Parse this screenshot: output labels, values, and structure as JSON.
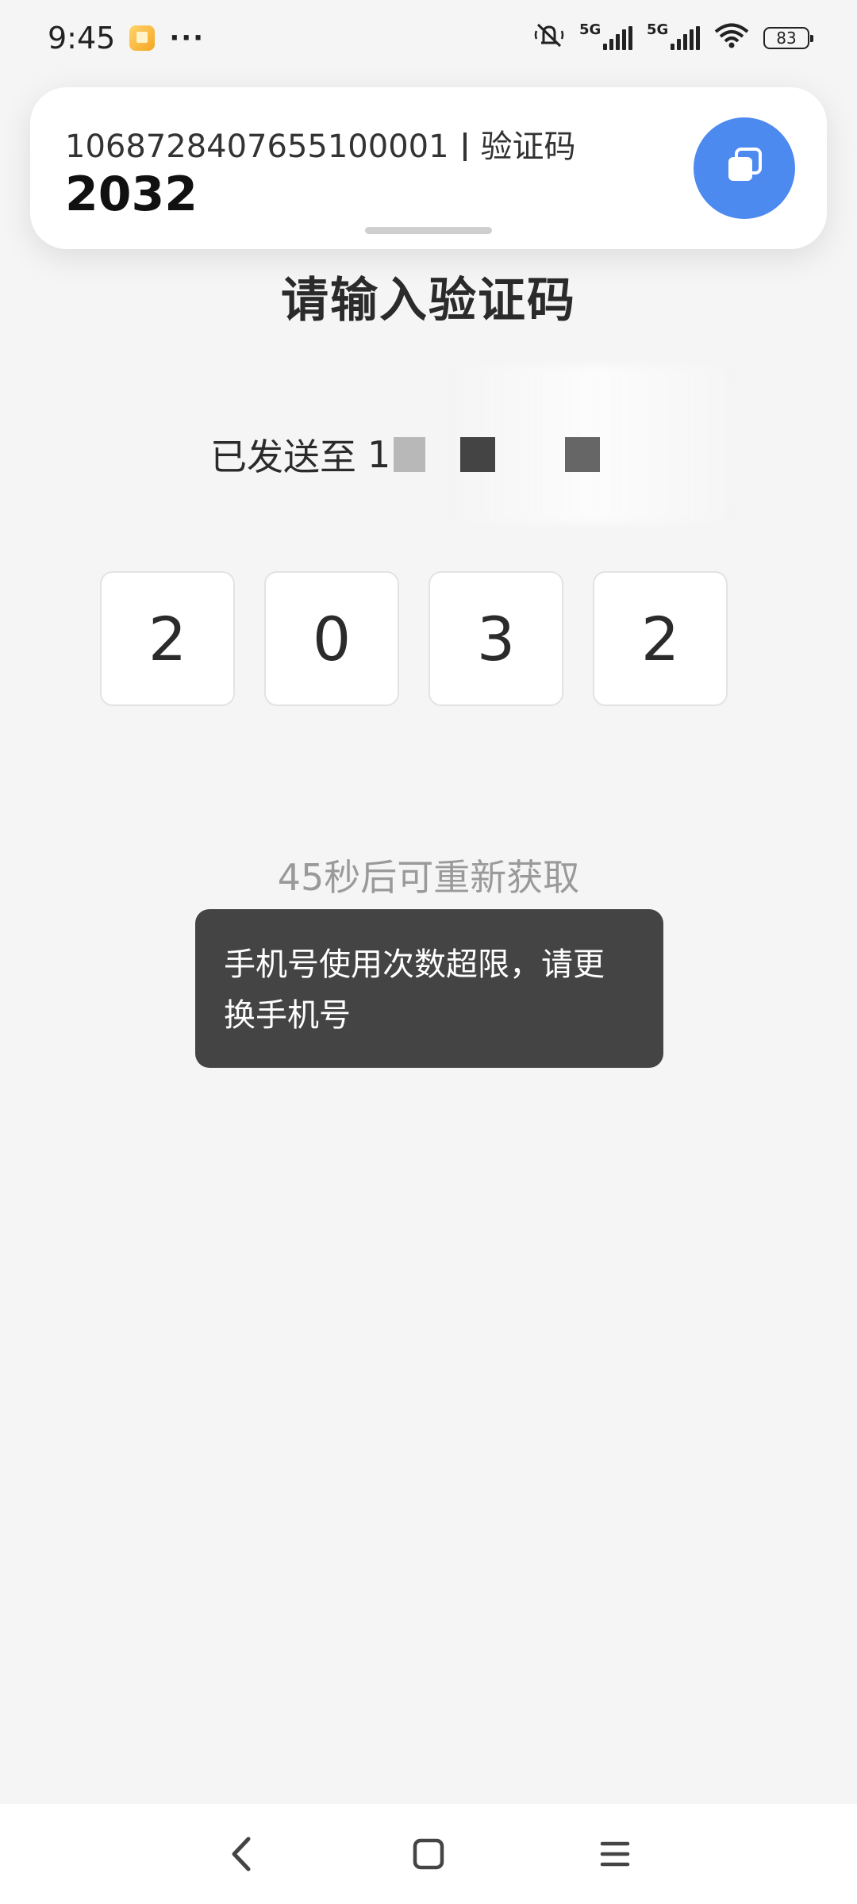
{
  "status_bar": {
    "time": "9:45",
    "more": "···",
    "network_1": "5G",
    "network_2": "5G",
    "battery": "83"
  },
  "notification": {
    "sender": "1068728407655100001",
    "category": "验证码",
    "code": "2032"
  },
  "page": {
    "title": "请输入验证码",
    "sent_to_label": "已发送至",
    "phone_visible": "1",
    "code_digits": [
      "2",
      "0",
      "3",
      "2"
    ],
    "resend_countdown": "45秒后可重新获取"
  },
  "toast": {
    "message": "手机号使用次数超限，请更换手机号"
  },
  "icons": {
    "copy": "copy-icon",
    "back": "back-icon",
    "home": "home-icon",
    "menu": "menu-icon"
  },
  "colors": {
    "accent": "#4d8af0",
    "toast_bg": "#444444",
    "background": "#f5f5f5"
  }
}
